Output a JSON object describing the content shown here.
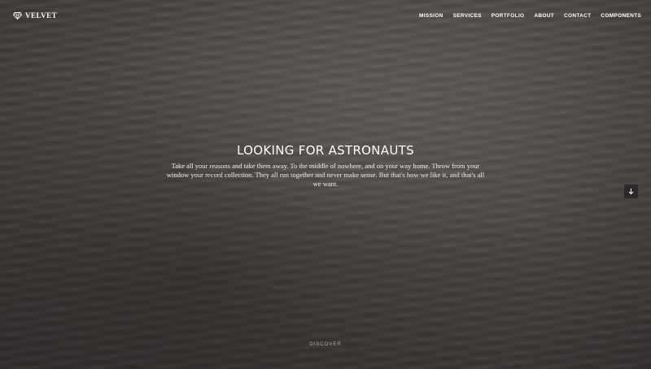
{
  "brand": {
    "name": "VELVET",
    "icon": "diamond-icon"
  },
  "nav": {
    "items": [
      {
        "label": "MISSION"
      },
      {
        "label": "SERVICES"
      },
      {
        "label": "PORTFOLIO"
      },
      {
        "label": "ABOUT"
      },
      {
        "label": "CONTACT"
      },
      {
        "label": "COMPONENTS"
      }
    ]
  },
  "hero": {
    "title": "LOOKING FOR ASTRONAUTS",
    "description": "Take all your reasons and take them away. To the middle of nowhere, and on your way home. Throw from your window your record collection. They all run together and never make sense. But that's how we like it, and that's all we want.",
    "scroll_icon": "arrow-down-icon",
    "discover_label": "DISCOVER"
  },
  "colors": {
    "text": "#ffffff",
    "scroll_button_bg": "#2b2828",
    "background": "#58514f"
  }
}
